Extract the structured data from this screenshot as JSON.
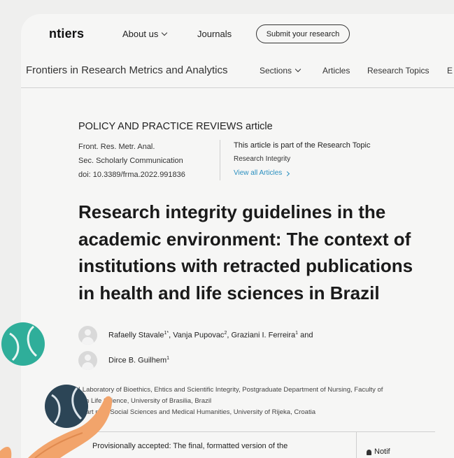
{
  "site": {
    "logo": "ntiers",
    "nav": [
      {
        "label": "About us",
        "has_dropdown": true
      },
      {
        "label": "Journals",
        "has_dropdown": false
      }
    ],
    "submit_label": "Submit your research"
  },
  "journal": {
    "title": "Frontiers in Research Metrics and Analytics",
    "nav": [
      {
        "label": "Sections",
        "has_dropdown": true
      },
      {
        "label": "Articles"
      },
      {
        "label": "Research Topics"
      },
      {
        "label": "E"
      }
    ]
  },
  "article": {
    "type": "POLICY AND PRACTICE REVIEWS article",
    "journal_abbrev": "Front. Res. Metr. Anal.",
    "section": "Sec. Scholarly Communication",
    "doi": "doi: 10.3389/frma.2022.991836",
    "topic_heading": "This article is part of the Research Topic",
    "topic_name": "Research Integrity",
    "topic_link": "View all Articles",
    "title_lines": [
      "Research integrity guidelines in the",
      "academic environment: The context of",
      "institutions with retracted publications",
      "in health and life sciences in Brazil"
    ],
    "authors": [
      {
        "name": "Rafaelly Stavale",
        "sup": "1*",
        "sep": ", "
      },
      {
        "name": "Vanja Pupovac",
        "sup": "2",
        "sep": ", "
      },
      {
        "name": "Graziani I. Ferreira",
        "sup": "1",
        "sep": " and"
      },
      {
        "name": "Dirce B. Guilhem",
        "sup": "1",
        "sep": ""
      }
    ],
    "affiliations": [
      "¹ Laboratory of Bioethics, Ehtics and Scientific Integrity, Postgraduate Department of Nursing, Faculty of",
      "alth  Life Science, University of Brasilia, Brazil",
      "epart  nt of Social Sciences and Medical Humanities, University of Rijeka, Croatia"
    ],
    "notice": "Provisionally accepted:  The final, formatted version of the",
    "notify_label": "Notif"
  },
  "colors": {
    "background": "#efefee",
    "teal_ball": "#2fae9a",
    "navy_ball": "#2c4556",
    "hand": "#f2a46b",
    "link": "#2a8fbf"
  }
}
